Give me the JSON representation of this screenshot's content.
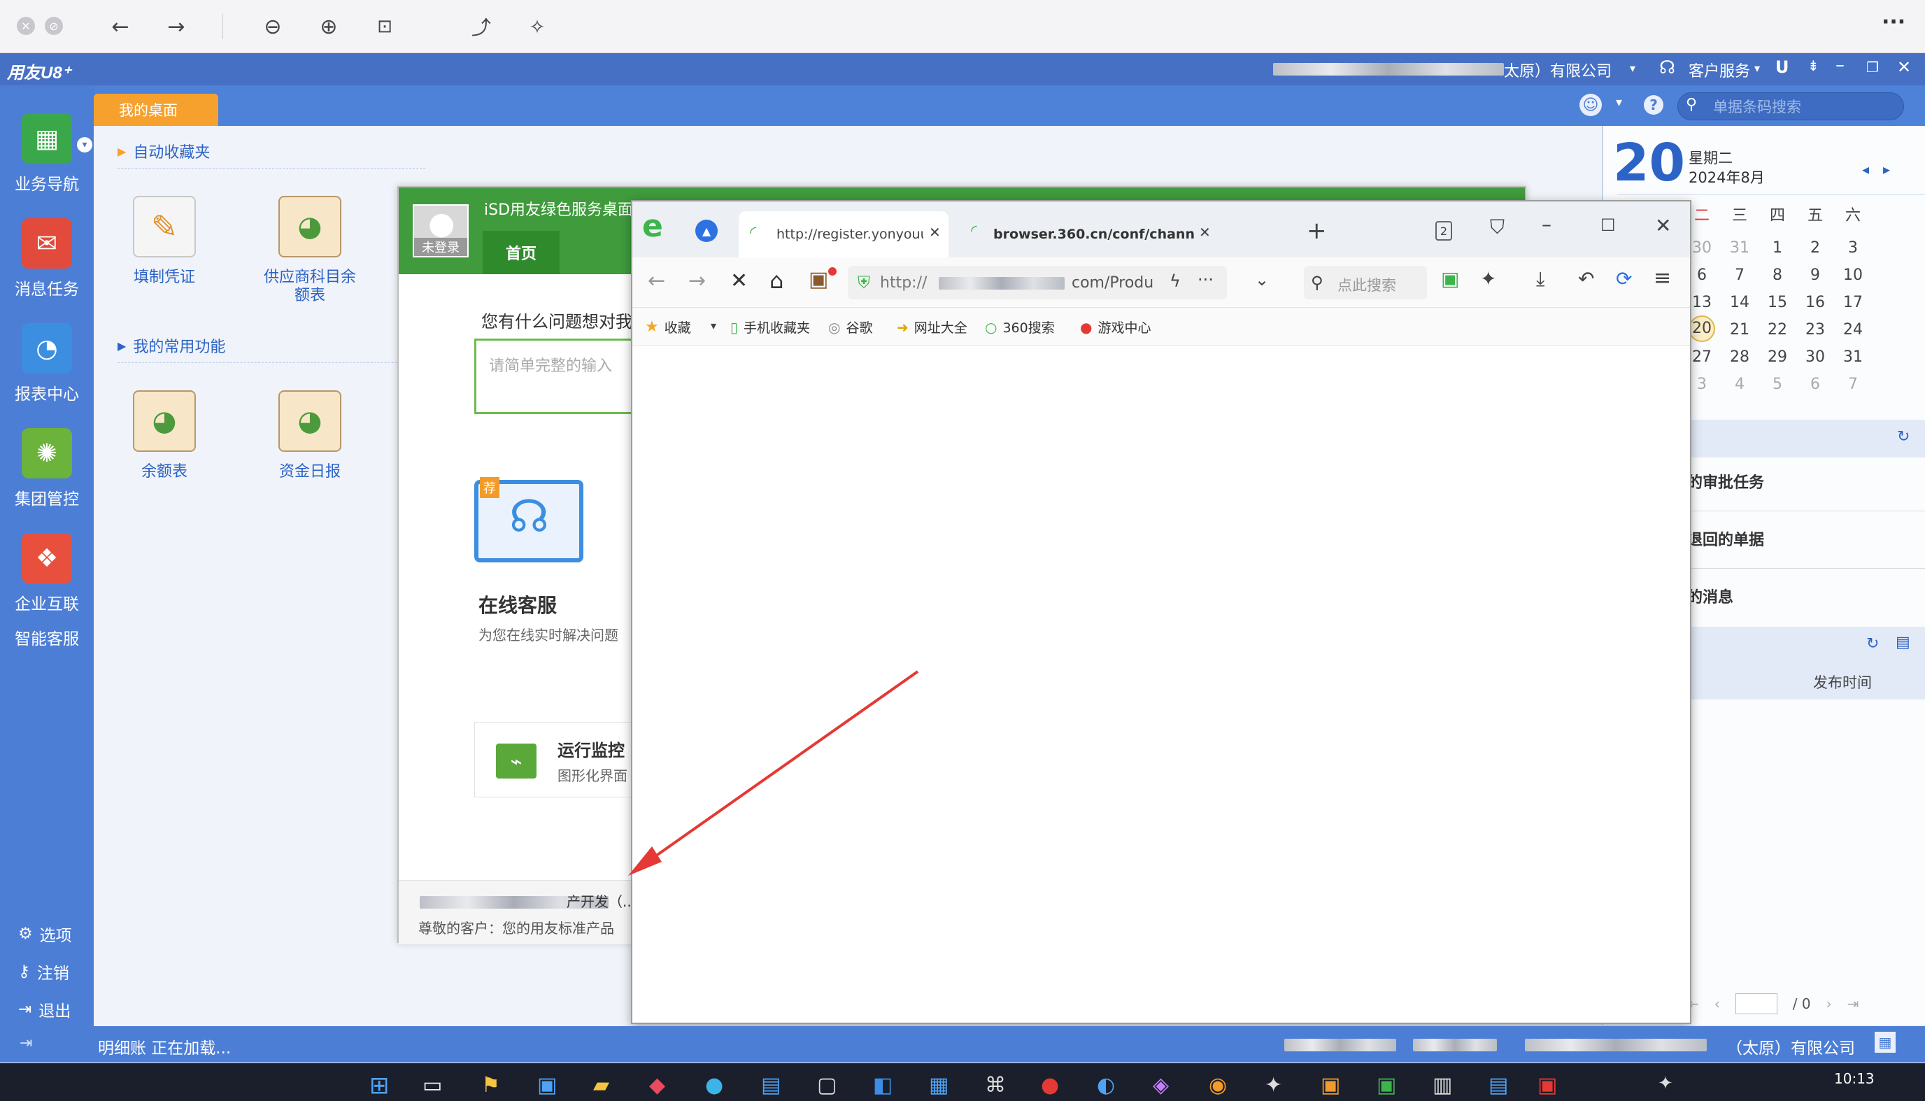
{
  "viewer": {
    "more_label": "···"
  },
  "u8": {
    "logo": "用友U8⁺",
    "company": "太原）有限公司",
    "customer_service": "客户服务",
    "tab_desktop": "我的桌面",
    "search_placeholder": "单据条码搜索",
    "nav": [
      {
        "label": "业务导航",
        "icon": "business-nav-icon"
      },
      {
        "label": "消息任务",
        "icon": "message-task-icon"
      },
      {
        "label": "报表中心",
        "icon": "report-center-icon"
      },
      {
        "label": "集团管控",
        "icon": "group-control-icon"
      },
      {
        "label": "企业互联",
        "icon": "enterprise-link-icon"
      }
    ],
    "smart_service": "智能客服",
    "options": [
      "选项",
      "注销",
      "退出"
    ],
    "section_favorites": "自动收藏夹",
    "section_common": "我的常用功能",
    "favorites": [
      "填制凭证",
      "供应商科目余额表"
    ],
    "common": [
      "余额表",
      "资金日报"
    ],
    "status_text": "明细账 正在加载...",
    "status_company": "（太原）有限公司"
  },
  "calendar": {
    "day": "20",
    "weekday": "星期二",
    "month": "2024年8月",
    "headers": [
      "二",
      "三",
      "四",
      "五",
      "六"
    ],
    "rows": [
      [
        "30",
        "31",
        "1",
        "2",
        "3"
      ],
      [
        "6",
        "7",
        "8",
        "9",
        "10"
      ],
      [
        "13",
        "14",
        "15",
        "16",
        "17"
      ],
      [
        "20",
        "21",
        "22",
        "23",
        "24"
      ],
      [
        "27",
        "28",
        "29",
        "30",
        "31"
      ],
      [
        "3",
        "4",
        "5",
        "6",
        "7"
      ]
    ],
    "tasks": [
      "的审批任务",
      "退回的单据",
      "的消息"
    ],
    "publish_time": "发布时间",
    "page_total": "/ 0"
  },
  "isd": {
    "title": "iSD用友绿色服务桌面",
    "not_logged": "未登录",
    "home_tab": "首页",
    "question": "您有什么问题想对我",
    "input_placeholder": "请简单完整的输入",
    "recommend_badge": "荐",
    "online_service": "在线客服",
    "online_desc": "为您在线实时解决问题",
    "monitor_title": "运行监控",
    "monitor_desc": "图形化界面",
    "notice_title": "产开发（...",
    "notice_text": "尊敬的客户：您的用友标准产品"
  },
  "browser": {
    "tab1_url": "http://register.yonyouup.com/Pr",
    "tab2_url": "browser.360.cn/conf/chann",
    "address_prefix": "http://",
    "address_suffix": "com/Produ",
    "search_placeholder": "点此搜索",
    "tab_count": "2",
    "bookmarks": [
      "收藏",
      "手机收藏夹",
      "谷歌",
      "网址大全",
      "360搜索",
      "游戏中心"
    ]
  },
  "taskbar": {
    "time": "10:13"
  },
  "colors": {
    "accent_blue": "#4c7ed6",
    "accent_orange": "#f6a12e",
    "isd_green": "#3f9b3c",
    "arrow_red": "#e53935"
  }
}
